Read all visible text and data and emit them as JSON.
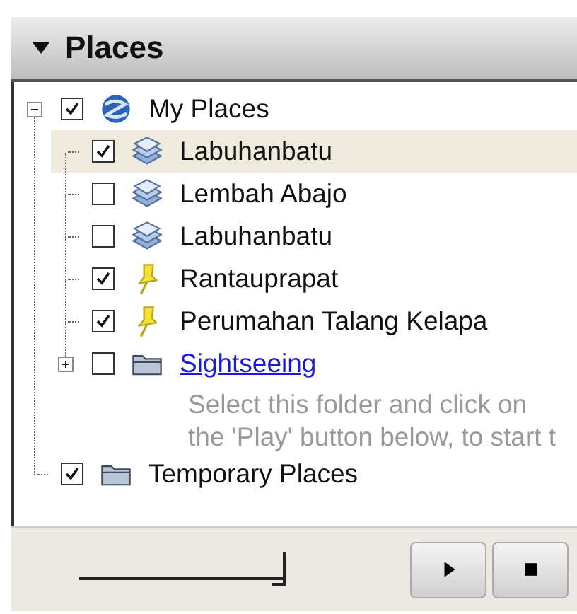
{
  "panel": {
    "title": "Places",
    "expanded": true
  },
  "tree": [
    {
      "label": "My Places",
      "kind": "globe",
      "checked": true,
      "selected": false,
      "link": false,
      "expanded": true,
      "children": [
        {
          "label": "Labuhanbatu",
          "kind": "layers",
          "checked": true,
          "selected": true,
          "link": false
        },
        {
          "label": "Lembah Abajo",
          "kind": "layers",
          "checked": false,
          "selected": false,
          "link": false
        },
        {
          "label": "Labuhanbatu",
          "kind": "layers",
          "checked": false,
          "selected": false,
          "link": false
        },
        {
          "label": "Rantauprapat",
          "kind": "pin",
          "checked": true,
          "selected": false,
          "link": false
        },
        {
          "label": "Perumahan Talang Kelapa",
          "kind": "pin",
          "checked": true,
          "selected": false,
          "link": false
        },
        {
          "label": "Sightseeing",
          "kind": "folder",
          "checked": false,
          "selected": false,
          "link": true,
          "expanded": false,
          "description": [
            "Select this folder and click on",
            "the 'Play' button below, to start t"
          ]
        }
      ]
    },
    {
      "label": "Temporary Places",
      "kind": "folder",
      "checked": true,
      "selected": false,
      "link": false
    }
  ],
  "tour_slider": {
    "level": 1
  }
}
